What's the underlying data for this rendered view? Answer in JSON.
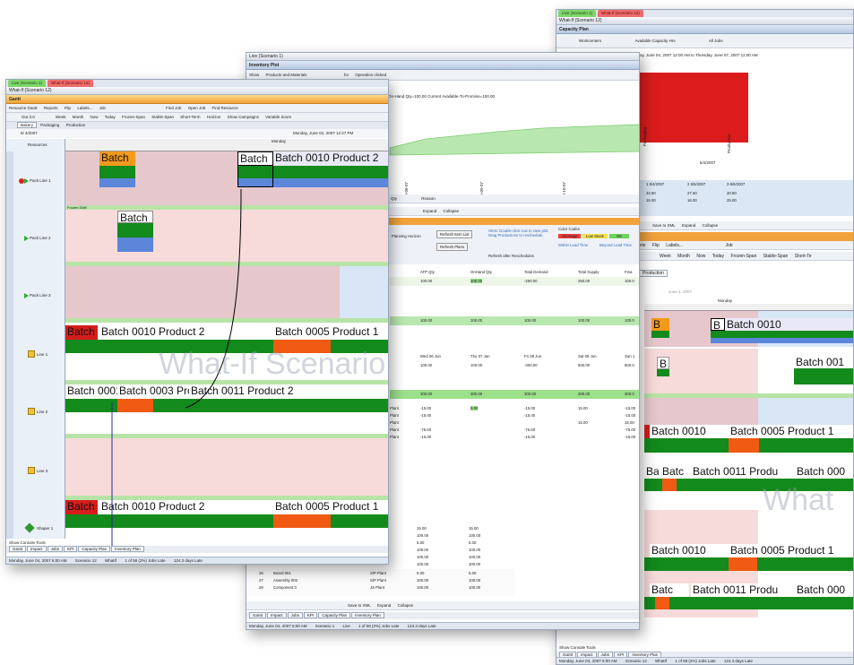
{
  "capacity_window": {
    "tabs": [
      "Live (Scenario 1)",
      "What-If (Scenario 12)"
    ],
    "title": "What-If (Scenario 12)",
    "header": "Capacity Plan",
    "toolbar": [
      "Workcenters",
      "Available Capacity Hrs",
      "All Jobs"
    ],
    "range_text": "nday, June 04, 2007 12:00 AM to Thursday, June 07, 2007 12:00 AM",
    "axis_labels": [
      "Packaging",
      "Production"
    ],
    "date_label": "6/4/2007",
    "table_header": [
      "1 6/4/2007",
      "2 6/5/2007",
      "3 6/6/2007"
    ],
    "table_rows": [
      [
        "34.50",
        "27.50",
        "20.50"
      ],
      [
        "16.00",
        "16.00",
        "25.00"
      ]
    ],
    "save_bar": [
      "Save to XML",
      "Expand",
      "Collapse"
    ],
    "toolbar2": [
      "orts",
      "Flip",
      "Labels...",
      "Job"
    ],
    "toolbar3": [
      "Week",
      "Month",
      "Now",
      "Today",
      "Frozen-Span",
      "Stable-Span",
      "Short-Te"
    ],
    "tab_production": "Production",
    "date_small": "June 4, 2007",
    "day_label": "Monday",
    "bars": [
      "B",
      "B",
      "Batch 0010",
      "B",
      "Batch 001",
      "Batch 0010",
      "Batch 0005 Product 1",
      "Ba",
      "Batc",
      "Batch 0011 Produ",
      "Batch 000",
      "Batch 0010",
      "Batch 0005 Product 1",
      "Batc",
      "Batch 0011 Produ",
      "Batch 000"
    ],
    "watermark": "What",
    "bottom_tabs": [
      "Gantt",
      "Impact",
      "Jobs",
      "KPI",
      "Inventory Plan"
    ],
    "status": [
      "Show Console Tools",
      "Monday, June 04, 2007 6:00 AM",
      "Scenario 12",
      "WhatIf",
      "1 of 58 (2%) Jobs Late",
      "124.3 days Late"
    ]
  },
  "inventory_window": {
    "title": "Live (Scenario 1)",
    "header": "Inventory Plot",
    "toolbar": [
      "Show",
      "Products and Materials",
      "for",
      "Operation clicked"
    ],
    "chart_caption": "On-Hand Qty=100.00   Current Available-To-Promise=100.00",
    "chart_dates": [
      "06-08-07",
      "06-09-07",
      "06-10-07"
    ],
    "filter_bar": [
      "Qty",
      "Reason"
    ],
    "expand_bar": [
      "Expand",
      "Collapse"
    ],
    "options": [
      "Planning Horizon",
      "Refresh Item List",
      "Refresh Plans",
      "Refresh after Reschedules"
    ],
    "hint": "Hints: Double-click row to view plot. Drag Productions to reschedule.",
    "color_codes_title": "Color Codes",
    "color_codes": [
      "Shortage",
      "Low Stock",
      "OK"
    ],
    "lead_labels": [
      "Within Lead Time",
      "Beyond Lead Time"
    ],
    "columns": [
      "ATP Qty",
      "OnHand Qty",
      "Total Demand",
      "Total Supply",
      "Fina"
    ],
    "dates": [
      "Wed 06 Jun",
      "Thu 07 Jun",
      "Fri 08 Jun",
      "Sat 09 Jun",
      "Sun 1"
    ],
    "values_rows": [
      [
        "100.00",
        "100.00",
        "-250.00",
        "250.00",
        "100.0"
      ],
      [
        "100.00",
        "100.00",
        "100.00",
        "100.00",
        "100.0"
      ],
      [
        "100.00",
        "100.00",
        "-300.00",
        "500.00",
        "500.0"
      ],
      [
        "300.00",
        "300.00",
        "300.00",
        "300.00",
        "300.0"
      ]
    ],
    "plan_rows": [
      [
        "Plant",
        "-15.00",
        "0.00",
        "-15.00",
        "15.00",
        "-15.00"
      ],
      [
        "Plant",
        "-15.00",
        "",
        "-15.00",
        "",
        "-15.00"
      ],
      [
        "Plant",
        "",
        "",
        "",
        "15.00",
        "15.00"
      ],
      [
        "Plant",
        "-75.00",
        "",
        "-75.00",
        "",
        "-75.00"
      ],
      [
        "Plant",
        "-15.00",
        "",
        "-15.00",
        "",
        "-15.00"
      ]
    ],
    "lower_rows": [
      [
        "15.00",
        "15.00"
      ],
      [
        "100.00",
        "100.00"
      ],
      [
        "5.00",
        "5.00"
      ],
      [
        "100.00",
        "100.00"
      ],
      [
        "100.00",
        "100.00"
      ],
      [
        "100.00",
        "100.00"
      ],
      [
        "100.00",
        "100.00"
      ]
    ],
    "item_rows": [
      [
        "26",
        "Board 001",
        "S/P Plant",
        "5.00",
        "5.00"
      ],
      [
        "27",
        "Assembly 002",
        "S/P Plant",
        "100.00",
        "100.00"
      ],
      [
        "28",
        "Component 3",
        "JS Plant",
        "100.00",
        "100.00"
      ]
    ],
    "bottom_toolbar": [
      "Save to XML",
      "Expand",
      "Collapse"
    ],
    "bottom_tabs": [
      "Gantt",
      "Impact",
      "Jobs",
      "KPI",
      "Capacity Plan",
      "Inventory Plan"
    ],
    "status": [
      "Monday, June 04, 2007 6:00 AM",
      "Scenario 1",
      "Live",
      "1 of 58 (2%) Jobs Late",
      "124.3 days Late"
    ]
  },
  "gantt_window": {
    "tabs": [
      "Live (Scenario 1)",
      "What-If (Scenario 12)"
    ],
    "title": "What-If (Scenario 12)",
    "header": "Gantt",
    "toolbar1": [
      "Resource Gantt",
      "Reports",
      "Flip",
      "Labels...",
      "Job",
      "Find Job",
      "Open Job",
      "Find Resource"
    ],
    "toolbar2": [
      "Out 3.0",
      "Week",
      "Month",
      "Now",
      "Today",
      "Frozen-Span",
      "Stable-Span",
      "Short-Term",
      "Horizon",
      "Show Campaigns",
      "Variable Zoom"
    ],
    "subtabs": [
      "Bakery",
      "Packaging",
      "Production"
    ],
    "date_left": "6/ 4/2007",
    "range_text": "Monday, June 04, 2007 12:27 PM",
    "day_label": "Monday",
    "resources_header": "Resources",
    "resources": [
      "Pack Line 1",
      "Pack Line 2",
      "Pack Line 3",
      "Line 1",
      "Line 2",
      "Line 3",
      "Shaper 1"
    ],
    "side_tabs": [
      "Batching",
      "Cleaning",
      "Packaging",
      "Production"
    ],
    "frozen_label": "Frozen Shift",
    "bars": [
      "Batch",
      "Batch",
      "Batch 0010 Product 2",
      "Batch",
      "Batch",
      "Batch 0010 Product 2",
      "Batch 0005 Product 1",
      "Batch 0001",
      "Batch 0003 Pro",
      "Batch 0011 Product 2",
      "Batch",
      "Batch 0010 Product 2",
      "Batch 0005 Product 1"
    ],
    "watermark": "What-If Scenario",
    "bottom_tabs": [
      "Gantt",
      "Impact",
      "Jobs",
      "KPI",
      "Capacity Plan",
      "Inventory Plan"
    ],
    "status": [
      "Show Console Tools",
      "Monday, June 04, 2007 6:00 AM",
      "Scenario 12",
      "WhatIf",
      "1 of 58 (2%) Jobs Late",
      "124.3 days Late"
    ]
  },
  "colors": {
    "batch_orange": "#f29a1c",
    "green": "#138a1c",
    "blue": "#5b86d9",
    "red": "#d61c1c",
    "orange_red": "#f05a12",
    "pink_lane": "#eac9cf",
    "live_tab": "#7fd66a",
    "whatif_tab": "#f06b6b"
  }
}
